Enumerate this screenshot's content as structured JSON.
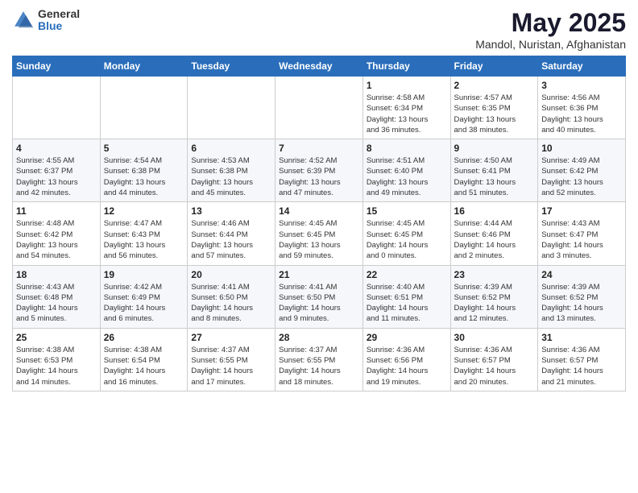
{
  "header": {
    "logo_general": "General",
    "logo_blue": "Blue",
    "month_title": "May 2025",
    "location": "Mandol, Nuristan, Afghanistan"
  },
  "weekdays": [
    "Sunday",
    "Monday",
    "Tuesday",
    "Wednesday",
    "Thursday",
    "Friday",
    "Saturday"
  ],
  "weeks": [
    [
      {
        "day": "",
        "info": ""
      },
      {
        "day": "",
        "info": ""
      },
      {
        "day": "",
        "info": ""
      },
      {
        "day": "",
        "info": ""
      },
      {
        "day": "1",
        "info": "Sunrise: 4:58 AM\nSunset: 6:34 PM\nDaylight: 13 hours\nand 36 minutes."
      },
      {
        "day": "2",
        "info": "Sunrise: 4:57 AM\nSunset: 6:35 PM\nDaylight: 13 hours\nand 38 minutes."
      },
      {
        "day": "3",
        "info": "Sunrise: 4:56 AM\nSunset: 6:36 PM\nDaylight: 13 hours\nand 40 minutes."
      }
    ],
    [
      {
        "day": "4",
        "info": "Sunrise: 4:55 AM\nSunset: 6:37 PM\nDaylight: 13 hours\nand 42 minutes."
      },
      {
        "day": "5",
        "info": "Sunrise: 4:54 AM\nSunset: 6:38 PM\nDaylight: 13 hours\nand 44 minutes."
      },
      {
        "day": "6",
        "info": "Sunrise: 4:53 AM\nSunset: 6:38 PM\nDaylight: 13 hours\nand 45 minutes."
      },
      {
        "day": "7",
        "info": "Sunrise: 4:52 AM\nSunset: 6:39 PM\nDaylight: 13 hours\nand 47 minutes."
      },
      {
        "day": "8",
        "info": "Sunrise: 4:51 AM\nSunset: 6:40 PM\nDaylight: 13 hours\nand 49 minutes."
      },
      {
        "day": "9",
        "info": "Sunrise: 4:50 AM\nSunset: 6:41 PM\nDaylight: 13 hours\nand 51 minutes."
      },
      {
        "day": "10",
        "info": "Sunrise: 4:49 AM\nSunset: 6:42 PM\nDaylight: 13 hours\nand 52 minutes."
      }
    ],
    [
      {
        "day": "11",
        "info": "Sunrise: 4:48 AM\nSunset: 6:42 PM\nDaylight: 13 hours\nand 54 minutes."
      },
      {
        "day": "12",
        "info": "Sunrise: 4:47 AM\nSunset: 6:43 PM\nDaylight: 13 hours\nand 56 minutes."
      },
      {
        "day": "13",
        "info": "Sunrise: 4:46 AM\nSunset: 6:44 PM\nDaylight: 13 hours\nand 57 minutes."
      },
      {
        "day": "14",
        "info": "Sunrise: 4:45 AM\nSunset: 6:45 PM\nDaylight: 13 hours\nand 59 minutes."
      },
      {
        "day": "15",
        "info": "Sunrise: 4:45 AM\nSunset: 6:45 PM\nDaylight: 14 hours\nand 0 minutes."
      },
      {
        "day": "16",
        "info": "Sunrise: 4:44 AM\nSunset: 6:46 PM\nDaylight: 14 hours\nand 2 minutes."
      },
      {
        "day": "17",
        "info": "Sunrise: 4:43 AM\nSunset: 6:47 PM\nDaylight: 14 hours\nand 3 minutes."
      }
    ],
    [
      {
        "day": "18",
        "info": "Sunrise: 4:43 AM\nSunset: 6:48 PM\nDaylight: 14 hours\nand 5 minutes."
      },
      {
        "day": "19",
        "info": "Sunrise: 4:42 AM\nSunset: 6:49 PM\nDaylight: 14 hours\nand 6 minutes."
      },
      {
        "day": "20",
        "info": "Sunrise: 4:41 AM\nSunset: 6:50 PM\nDaylight: 14 hours\nand 8 minutes."
      },
      {
        "day": "21",
        "info": "Sunrise: 4:41 AM\nSunset: 6:50 PM\nDaylight: 14 hours\nand 9 minutes."
      },
      {
        "day": "22",
        "info": "Sunrise: 4:40 AM\nSunset: 6:51 PM\nDaylight: 14 hours\nand 11 minutes."
      },
      {
        "day": "23",
        "info": "Sunrise: 4:39 AM\nSunset: 6:52 PM\nDaylight: 14 hours\nand 12 minutes."
      },
      {
        "day": "24",
        "info": "Sunrise: 4:39 AM\nSunset: 6:52 PM\nDaylight: 14 hours\nand 13 minutes."
      }
    ],
    [
      {
        "day": "25",
        "info": "Sunrise: 4:38 AM\nSunset: 6:53 PM\nDaylight: 14 hours\nand 14 minutes."
      },
      {
        "day": "26",
        "info": "Sunrise: 4:38 AM\nSunset: 6:54 PM\nDaylight: 14 hours\nand 16 minutes."
      },
      {
        "day": "27",
        "info": "Sunrise: 4:37 AM\nSunset: 6:55 PM\nDaylight: 14 hours\nand 17 minutes."
      },
      {
        "day": "28",
        "info": "Sunrise: 4:37 AM\nSunset: 6:55 PM\nDaylight: 14 hours\nand 18 minutes."
      },
      {
        "day": "29",
        "info": "Sunrise: 4:36 AM\nSunset: 6:56 PM\nDaylight: 14 hours\nand 19 minutes."
      },
      {
        "day": "30",
        "info": "Sunrise: 4:36 AM\nSunset: 6:57 PM\nDaylight: 14 hours\nand 20 minutes."
      },
      {
        "day": "31",
        "info": "Sunrise: 4:36 AM\nSunset: 6:57 PM\nDaylight: 14 hours\nand 21 minutes."
      }
    ]
  ]
}
